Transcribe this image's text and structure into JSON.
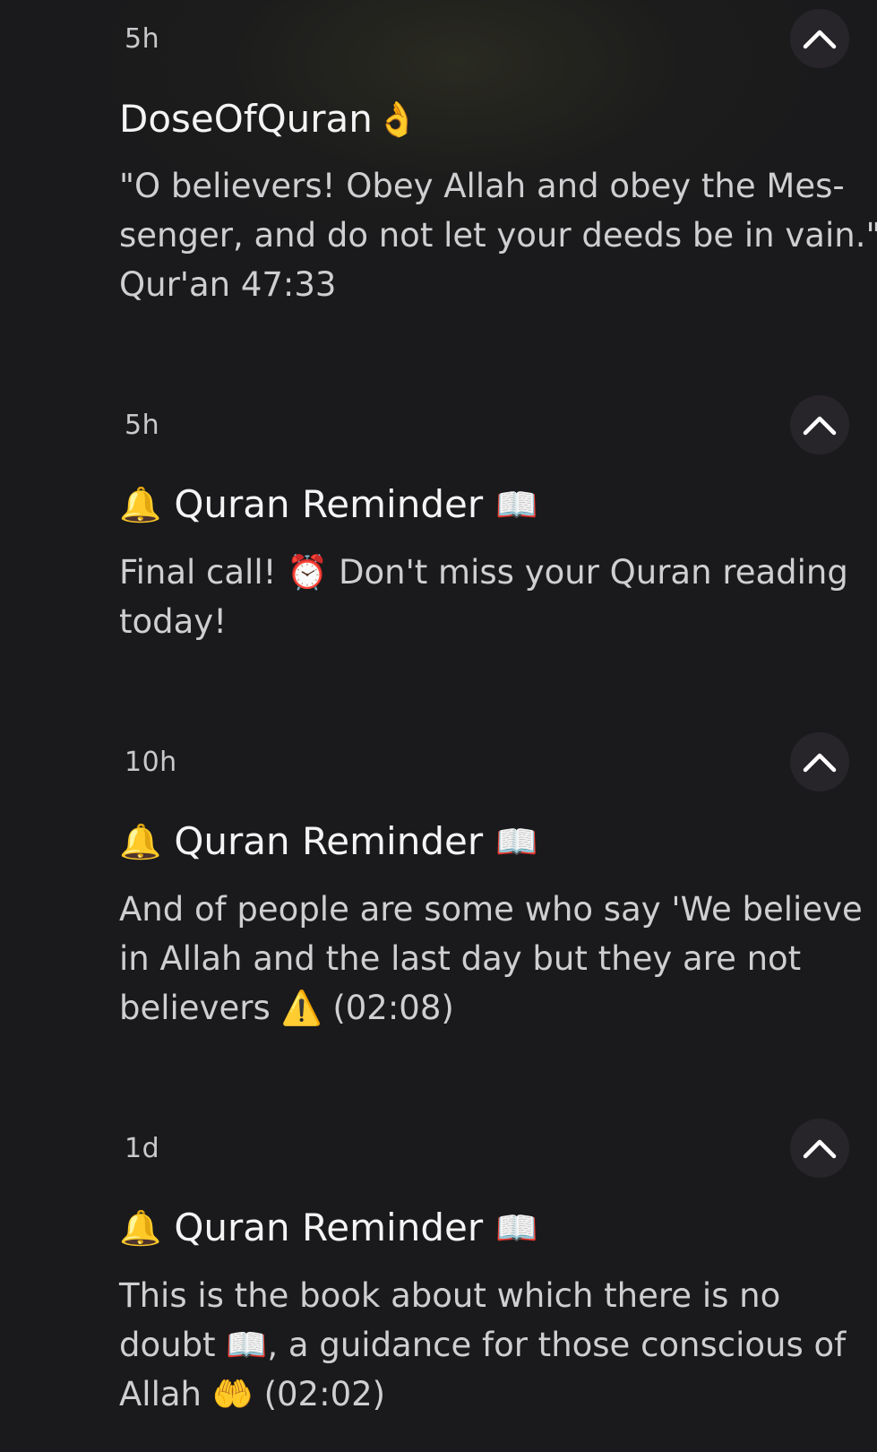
{
  "notifications": [
    {
      "time": "5h",
      "title_prefix": "",
      "title": "DoseOfQuran",
      "title_suffix": "👌",
      "body_lines": [
        "\"O believers! Obey Allah and obey the Mes-",
        "senger, and do not let your deeds be in vain.\"",
        "Qur'an 47:33"
      ]
    },
    {
      "time": "5h",
      "title_prefix": "🔔",
      "title": "Quran Reminder",
      "title_suffix": "📖",
      "body_lines": [
        "Final call! ⏰ Don't miss your Quran reading",
        "today!"
      ]
    },
    {
      "time": "10h",
      "title_prefix": "🔔",
      "title": "Quran Reminder",
      "title_suffix": "📖",
      "body_lines": [
        "And of people are some who say 'We believe",
        "in Allah and the last day but they are not",
        "believers ⚠️ (02:08)"
      ]
    },
    {
      "time": "1d",
      "title_prefix": "🔔",
      "title": "Quran Reminder",
      "title_suffix": "📖",
      "body_lines": [
        "This is the book about which there is no",
        "doubt 📖, a guidance for those conscious of",
        "Allah 🤲 (02:02)"
      ]
    }
  ],
  "icons": {
    "collapse": "chevron-up-icon"
  },
  "colors": {
    "background": "#1a1a1c",
    "button_bg": "#28252a",
    "title": "#f4f4f5",
    "body": "#cfcfd2"
  }
}
